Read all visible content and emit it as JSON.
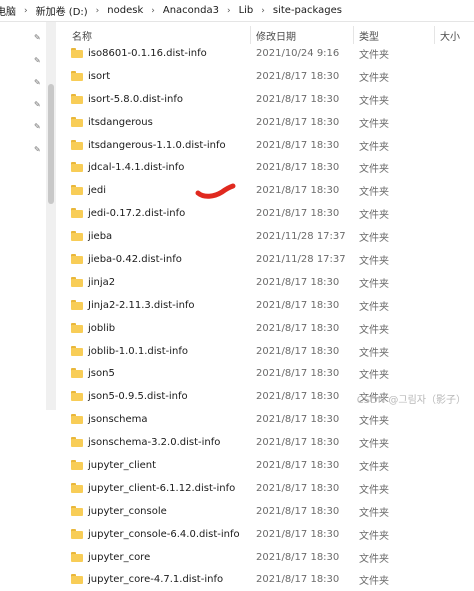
{
  "breadcrumb": {
    "items": [
      "电脑",
      "新加卷 (D:)",
      "nodesk",
      "Anaconda3",
      "Lib",
      "site-packages"
    ],
    "separator": "›"
  },
  "columns": {
    "name": "名称",
    "date": "修改日期",
    "type": "类型",
    "size": "大小"
  },
  "files": [
    {
      "name": "iso8601-0.1.16.dist-info",
      "date": "2021/10/24 9:16",
      "type": "文件夹"
    },
    {
      "name": "isort",
      "date": "2021/8/17 18:30",
      "type": "文件夹"
    },
    {
      "name": "isort-5.8.0.dist-info",
      "date": "2021/8/17 18:30",
      "type": "文件夹"
    },
    {
      "name": "itsdangerous",
      "date": "2021/8/17 18:30",
      "type": "文件夹"
    },
    {
      "name": "itsdangerous-1.1.0.dist-info",
      "date": "2021/8/17 18:30",
      "type": "文件夹"
    },
    {
      "name": "jdcal-1.4.1.dist-info",
      "date": "2021/8/17 18:30",
      "type": "文件夹"
    },
    {
      "name": "jedi",
      "date": "2021/8/17 18:30",
      "type": "文件夹"
    },
    {
      "name": "jedi-0.17.2.dist-info",
      "date": "2021/8/17 18:30",
      "type": "文件夹"
    },
    {
      "name": "jieba",
      "date": "2021/11/28 17:37",
      "type": "文件夹"
    },
    {
      "name": "jieba-0.42.dist-info",
      "date": "2021/11/28 17:37",
      "type": "文件夹"
    },
    {
      "name": "jinja2",
      "date": "2021/8/17 18:30",
      "type": "文件夹"
    },
    {
      "name": "Jinja2-2.11.3.dist-info",
      "date": "2021/8/17 18:30",
      "type": "文件夹"
    },
    {
      "name": "joblib",
      "date": "2021/8/17 18:30",
      "type": "文件夹"
    },
    {
      "name": "joblib-1.0.1.dist-info",
      "date": "2021/8/17 18:30",
      "type": "文件夹"
    },
    {
      "name": "json5",
      "date": "2021/8/17 18:30",
      "type": "文件夹"
    },
    {
      "name": "json5-0.9.5.dist-info",
      "date": "2021/8/17 18:30",
      "type": "文件夹"
    },
    {
      "name": "jsonschema",
      "date": "2021/8/17 18:30",
      "type": "文件夹"
    },
    {
      "name": "jsonschema-3.2.0.dist-info",
      "date": "2021/8/17 18:30",
      "type": "文件夹"
    },
    {
      "name": "jupyter_client",
      "date": "2021/8/17 18:30",
      "type": "文件夹"
    },
    {
      "name": "jupyter_client-6.1.12.dist-info",
      "date": "2021/8/17 18:30",
      "type": "文件夹"
    },
    {
      "name": "jupyter_console",
      "date": "2021/8/17 18:30",
      "type": "文件夹"
    },
    {
      "name": "jupyter_console-6.4.0.dist-info",
      "date": "2021/8/17 18:30",
      "type": "文件夹"
    },
    {
      "name": "jupyter_core",
      "date": "2021/8/17 18:30",
      "type": "文件夹"
    },
    {
      "name": "jupyter_core-4.7.1.dist-info",
      "date": "2021/8/17 18:30",
      "type": "文件夹"
    }
  ],
  "watermark": "CSDN @그림자（影子）",
  "colors": {
    "folder": "#f8cd57",
    "annotation": "#e0291f"
  },
  "icons": {
    "folder": "folder-icon",
    "pin": "pin-icon"
  }
}
